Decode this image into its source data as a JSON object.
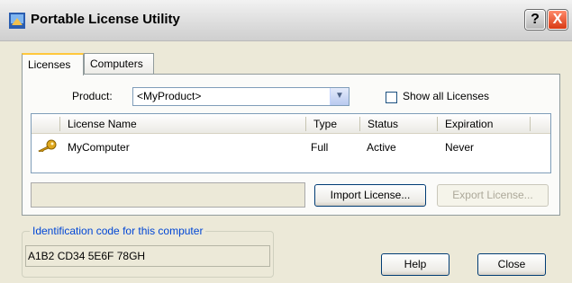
{
  "window": {
    "title": "Portable License Utility",
    "help_glyph": "?",
    "close_glyph": "X"
  },
  "tabs": [
    {
      "label": "Licenses",
      "active": true
    },
    {
      "label": "Computers",
      "active": false
    }
  ],
  "product": {
    "label": "Product:",
    "selected": "<MyProduct>",
    "dropdown_glyph": "▼"
  },
  "show_all": {
    "label": "Show all Licenses",
    "checked": false
  },
  "license_table": {
    "columns": [
      "License Name",
      "Type",
      "Status",
      "Expiration"
    ],
    "rows": [
      {
        "icon": "key-icon",
        "name": "MyComputer",
        "type": "Full",
        "status": "Active",
        "expiration": "Never"
      }
    ]
  },
  "buttons": {
    "import": "Import License...",
    "export": "Export License...",
    "help": "Help",
    "close": "Close"
  },
  "identification": {
    "title": "Identification code for this computer",
    "code": "A1B2 CD34 5E6F 78GH"
  },
  "colors": {
    "group_title": "#0046d5",
    "tab_highlight": "#ffc73c",
    "close_button": "#d83a14"
  }
}
